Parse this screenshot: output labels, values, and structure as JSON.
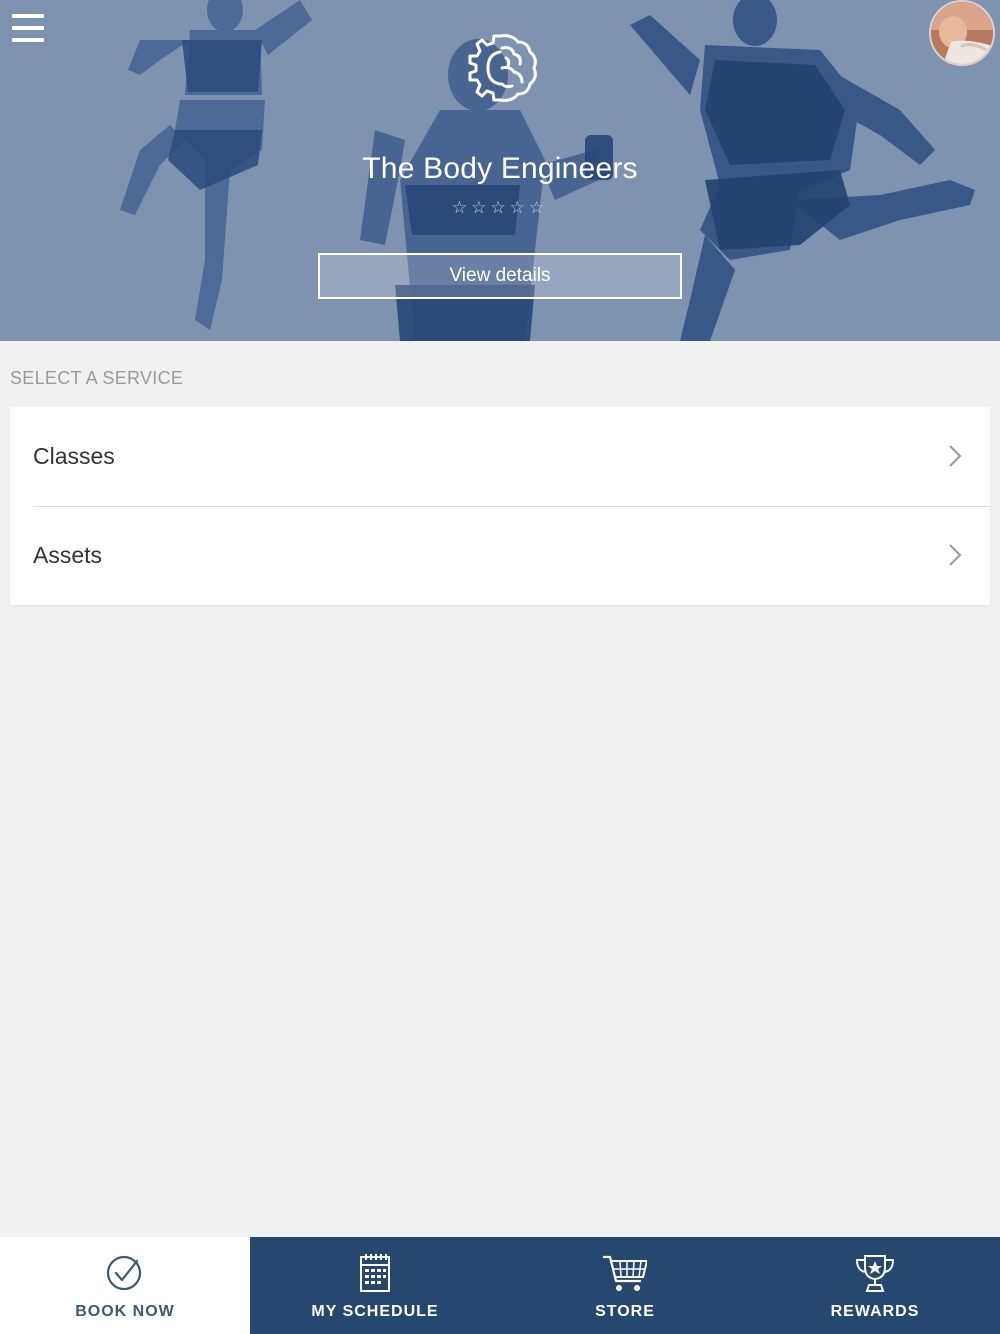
{
  "header": {
    "menu_icon": "hamburger-icon",
    "logo_icon": "brain-gear-icon",
    "business_name": "The Body Engineers",
    "rating_stars": "☆☆☆☆☆",
    "rating_value": 0,
    "rating_max": 5,
    "view_details_label": "View details",
    "avatar": "user-avatar"
  },
  "services": {
    "section_title": "SELECT A SERVICE",
    "items": [
      {
        "label": "Classes",
        "icon": "chevron-right-icon"
      },
      {
        "label": "Assets",
        "icon": "chevron-right-icon"
      }
    ]
  },
  "bottom_nav": {
    "items": [
      {
        "label": "BOOK NOW",
        "icon": "check-circle-icon",
        "active": true
      },
      {
        "label": "MY SCHEDULE",
        "icon": "calendar-icon",
        "active": false
      },
      {
        "label": "STORE",
        "icon": "cart-icon",
        "active": false
      },
      {
        "label": "REWARDS",
        "icon": "trophy-icon",
        "active": false
      }
    ]
  },
  "colors": {
    "hero_overlay": "#7e93b0",
    "nav_background": "#26486f",
    "nav_active_background": "#ffffff",
    "nav_active_text": "#3f5873",
    "page_background": "#f1f1f1"
  }
}
